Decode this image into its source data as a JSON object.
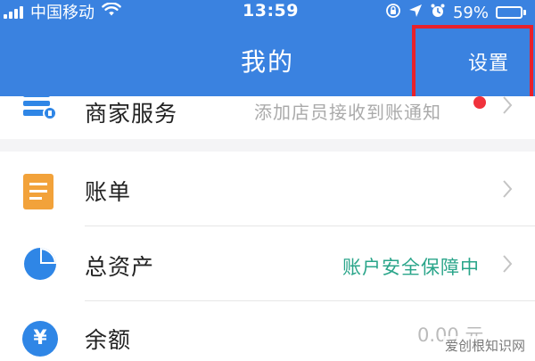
{
  "status_bar": {
    "carrier": "中国移动",
    "time": "13:59",
    "battery": "59%",
    "battery_level": 0.59,
    "icons": [
      "signal-icon",
      "wifi-icon",
      "orientation-lock-icon",
      "location-icon",
      "alarm-icon",
      "battery-icon"
    ]
  },
  "nav": {
    "title": "我的",
    "settings_label": "设置"
  },
  "rows": {
    "merchant": {
      "label": "商家服务",
      "hint": "添加店员接收到账通知",
      "icon": "merchant-service-icon"
    },
    "bill": {
      "label": "账单",
      "icon": "bill-icon"
    },
    "assets": {
      "label": "总资产",
      "status": "账户安全保障中",
      "icon": "pie-chart-icon"
    },
    "balance": {
      "label": "余额",
      "value": "0.00 元",
      "icon_glyph": "¥",
      "icon": "yuan-icon"
    }
  },
  "watermark": "爱创根知识网",
  "colors": {
    "header_blue": "#3a82e0",
    "highlight_red": "#e8212b",
    "status_green": "#2aa58a",
    "bill_orange": "#f2a23a",
    "icon_blue": "#2f86e6",
    "notify_red": "#f0323c"
  }
}
